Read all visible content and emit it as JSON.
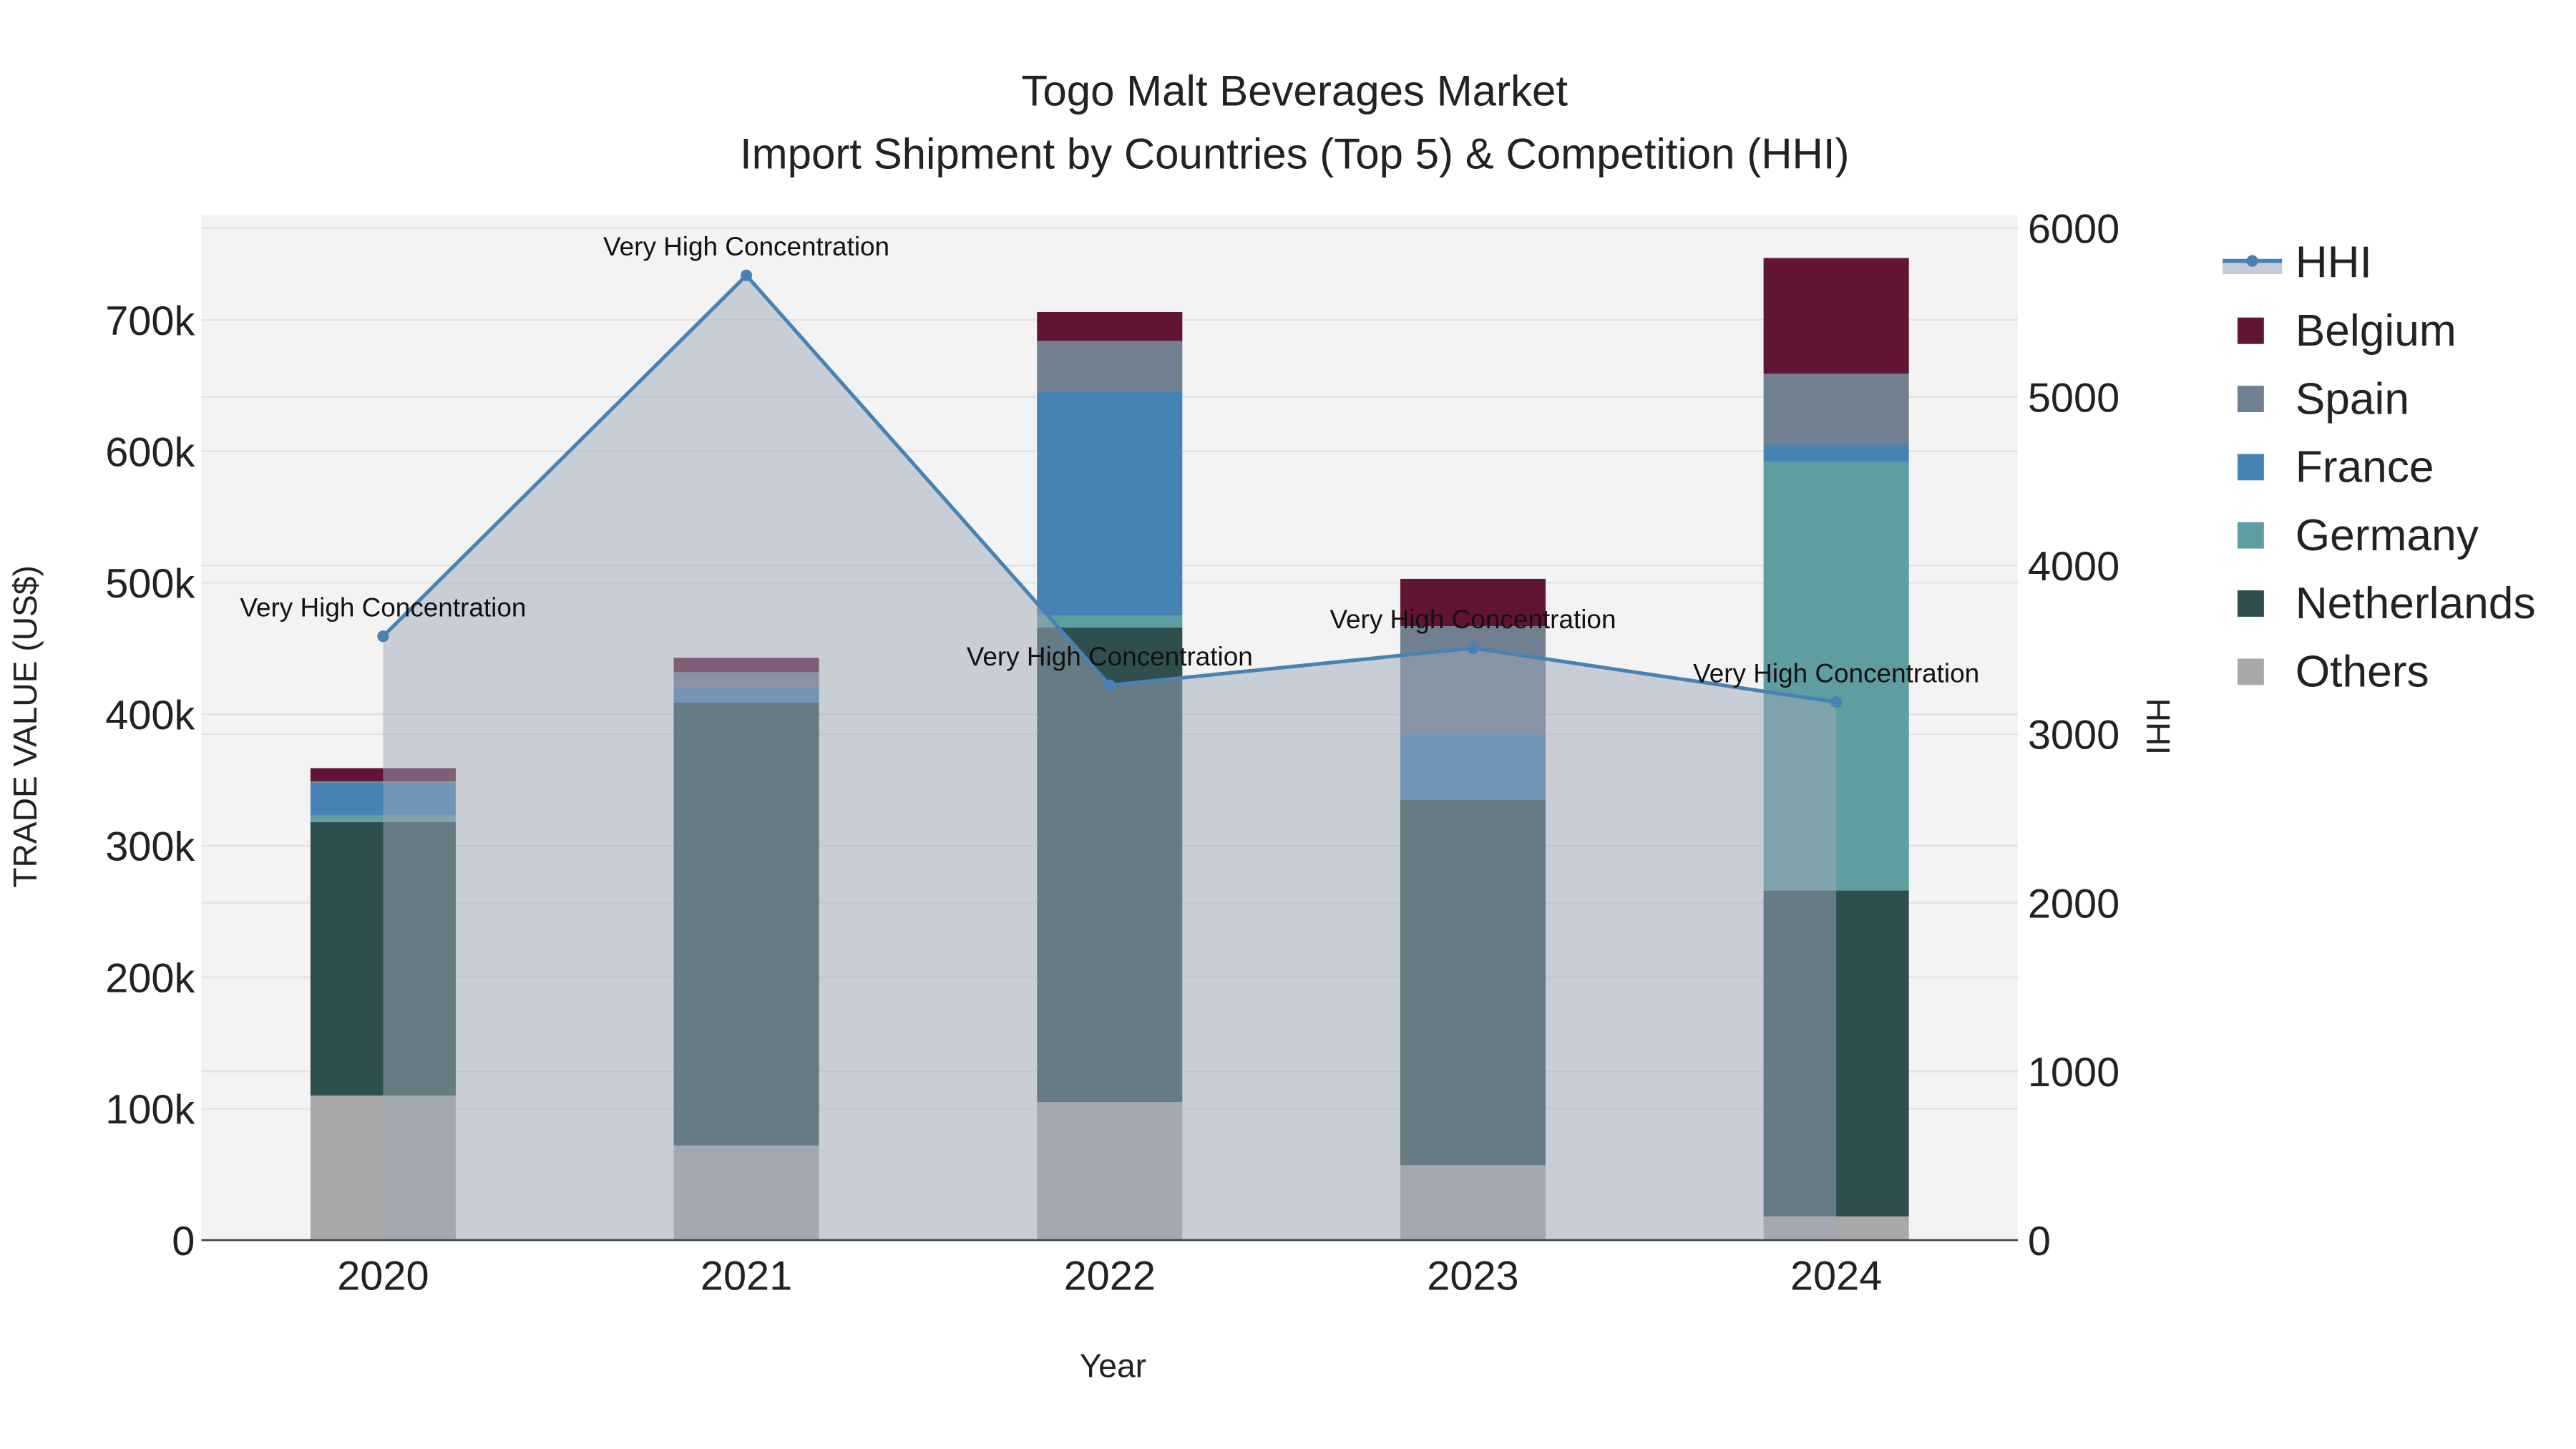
{
  "chart_data": {
    "type": "bar",
    "stacked": true,
    "title": "Togo Malt Beverages Market",
    "subtitle": "Import Shipment by Countries (Top 5) & Competition (HHI)",
    "xlabel": "Year",
    "ylabel": "TRADE VALUE (US$)",
    "y2label": "HHI",
    "categories": [
      "2020",
      "2021",
      "2022",
      "2023",
      "2024"
    ],
    "ylim": [
      0,
      780000
    ],
    "yticks": [
      0,
      100000,
      200000,
      300000,
      400000,
      500000,
      600000,
      700000
    ],
    "ytick_labels": [
      "0",
      "100k",
      "200k",
      "300k",
      "400k",
      "500k",
      "600k",
      "700k"
    ],
    "y2lim": [
      0,
      6080
    ],
    "y2ticks": [
      0,
      1000,
      2000,
      3000,
      4000,
      5000,
      6000
    ],
    "y2tick_labels": [
      "0",
      "1000",
      "2000",
      "3000",
      "4000",
      "5000",
      "6000"
    ],
    "series": [
      {
        "name": "Others",
        "color": "#a9a9a9",
        "values": [
          110000,
          72000,
          105000,
          57000,
          18000
        ]
      },
      {
        "name": "Netherlands",
        "color": "#2f4f4f",
        "values": [
          208000,
          337000,
          361000,
          278000,
          248000
        ]
      },
      {
        "name": "Germany",
        "color": "#5f9ea0",
        "values": [
          5000,
          0,
          9000,
          0,
          326000
        ]
      },
      {
        "name": "France",
        "color": "#4682b4",
        "values": [
          25000,
          11000,
          171000,
          50000,
          13000
        ]
      },
      {
        "name": "Spain",
        "color": "#708090",
        "values": [
          1000,
          12000,
          38000,
          82000,
          54000
        ]
      },
      {
        "name": "Belgium",
        "color": "#611434",
        "values": [
          10000,
          11000,
          22000,
          36000,
          88000
        ]
      }
    ],
    "hhi": {
      "name": "HHI",
      "color": "#4682b4",
      "values": [
        3580,
        5720,
        3290,
        3510,
        3190
      ],
      "annotations": [
        "Very High Concentration",
        "Very High Concentration",
        "Very High Concentration",
        "Very High Concentration",
        "Very High Concentration"
      ]
    },
    "legend": [
      "HHI",
      "Belgium",
      "Spain",
      "France",
      "Germany",
      "Netherlands",
      "Others"
    ],
    "legend_position": "right",
    "grid": true
  }
}
